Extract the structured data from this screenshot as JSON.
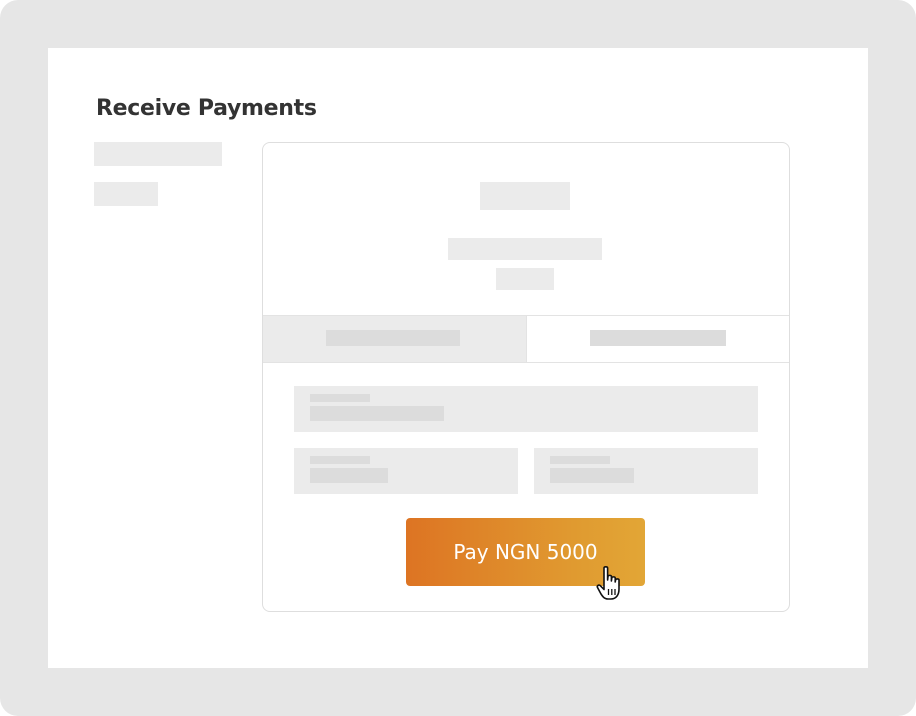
{
  "page": {
    "title": "Receive Payments"
  },
  "payment": {
    "pay_button_label": "Pay NGN 5000"
  },
  "colors": {
    "accent_start": "#dd7423",
    "accent_end": "#e2a636",
    "placeholder": "#ebebeb"
  },
  "icons": {
    "cursor": "hand-pointer-icon"
  }
}
